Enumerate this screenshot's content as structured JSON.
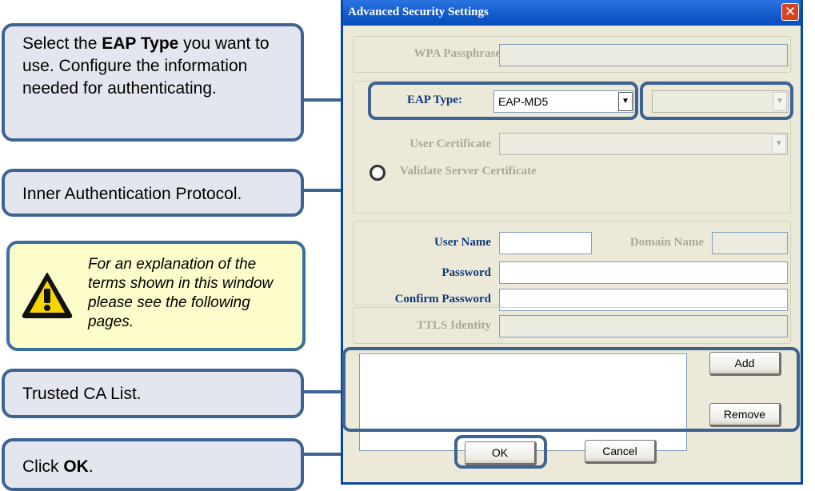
{
  "callouts": {
    "eap": {
      "pre": "Select the ",
      "bold": "EAP Type",
      "post": " you want to use. Configure the information needed for authenticating."
    },
    "inner": {
      "text": "Inner Authentication Protocol."
    },
    "note": {
      "text": "For an explanation of the terms shown in this window please see the following pages."
    },
    "trusted": {
      "text": "Trusted CA List."
    },
    "ok": {
      "pre": "Click ",
      "bold": "OK",
      "post": "."
    }
  },
  "dialog": {
    "title": "Advanced Security Settings",
    "close_glyph": "✕",
    "wpa_label": "WPA Passphrase",
    "eap_label": "EAP Type:",
    "eap_value": "EAP-MD5",
    "combo_arrow": "▼",
    "user_cert_label": "User Certificate",
    "validate_label": "Validate Server Certificate",
    "username_label": "User Name",
    "domain_label": "Domain Name",
    "password_label": "Password",
    "confirm_label": "Confirm Password",
    "ttls_label": "TTLS Identity",
    "add_label": "Add",
    "remove_label": "Remove",
    "ok_label": "OK",
    "cancel_label": "Cancel"
  },
  "colors": {
    "callout_border": "#3d6491",
    "callout_fill": "#e3e6ee",
    "note_fill": "#fdfccb",
    "titlebar": "#0c5dc9",
    "client": "#ece9d8"
  }
}
